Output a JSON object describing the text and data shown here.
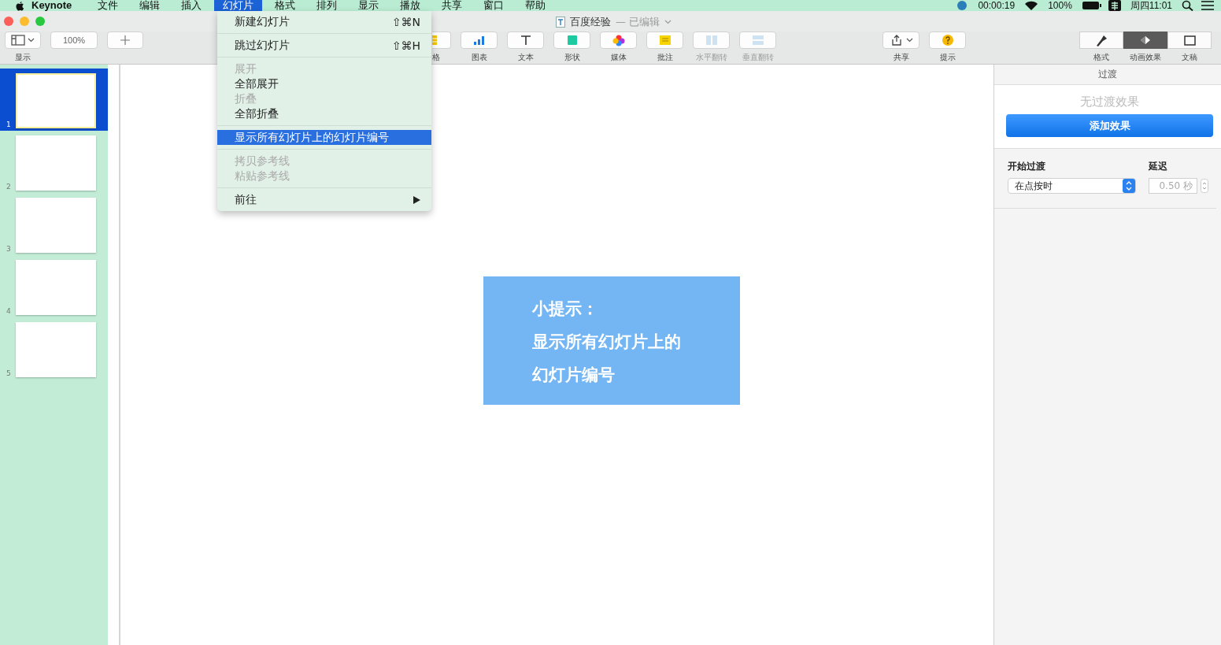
{
  "menubar": {
    "app": "Keynote",
    "menus": [
      {
        "label": "文件",
        "selected": false
      },
      {
        "label": "编辑",
        "selected": false
      },
      {
        "label": "插入",
        "selected": false
      },
      {
        "label": "幻灯片",
        "selected": true
      },
      {
        "label": "格式",
        "selected": false
      },
      {
        "label": "排列",
        "selected": false
      },
      {
        "label": "显示",
        "selected": false
      },
      {
        "label": "播放",
        "selected": false
      },
      {
        "label": "共享",
        "selected": false
      },
      {
        "label": "窗口",
        "selected": false
      },
      {
        "label": "帮助",
        "selected": false
      }
    ],
    "status": {
      "timer": "00:00:19",
      "battery": "100%",
      "clock": "周四11:01"
    }
  },
  "window": {
    "title": "百度经验",
    "subtitle": "— 已编辑"
  },
  "toolbar": {
    "left": [
      {
        "kind": "view",
        "label": "显示"
      },
      {
        "kind": "zoom",
        "value": "100%"
      },
      {
        "kind": "add"
      }
    ],
    "center": [
      {
        "label": "格",
        "disabled": false
      },
      {
        "label": "图表",
        "disabled": false
      },
      {
        "label": "文本",
        "disabled": false
      },
      {
        "label": "形状",
        "disabled": false
      },
      {
        "label": "媒体",
        "disabled": false
      },
      {
        "label": "批注",
        "disabled": false
      },
      {
        "label": "水平翻转",
        "disabled": true
      },
      {
        "label": "垂直翻转",
        "disabled": true
      }
    ],
    "right": [
      {
        "label": "共享"
      },
      {
        "label": "提示"
      }
    ],
    "inspector_tabs": [
      {
        "label": "格式",
        "selected": false
      },
      {
        "label": "动画效果",
        "selected": true
      },
      {
        "label": "文稿",
        "selected": false
      }
    ]
  },
  "menu": [
    {
      "kind": "item",
      "label": "新建幻灯片",
      "shortcut": "⇧⌘N",
      "disabled": false,
      "selected": false
    },
    {
      "kind": "separator"
    },
    {
      "kind": "item",
      "label": "跳过幻灯片",
      "shortcut": "⇧⌘H",
      "disabled": false,
      "selected": false
    },
    {
      "kind": "separator"
    },
    {
      "kind": "item",
      "label": "展开",
      "disabled": true,
      "selected": false
    },
    {
      "kind": "item",
      "label": "全部展开",
      "disabled": false,
      "selected": false
    },
    {
      "kind": "item",
      "label": "折叠",
      "disabled": true,
      "selected": false
    },
    {
      "kind": "item",
      "label": "全部折叠",
      "disabled": false,
      "selected": false
    },
    {
      "kind": "separator"
    },
    {
      "kind": "item",
      "label": "显示所有幻灯片上的幻灯片编号",
      "disabled": false,
      "selected": true
    },
    {
      "kind": "separator"
    },
    {
      "kind": "item",
      "label": "拷贝参考线",
      "disabled": true,
      "selected": false
    },
    {
      "kind": "item",
      "label": "粘贴参考线",
      "disabled": true,
      "selected": false
    },
    {
      "kind": "separator"
    },
    {
      "kind": "submenu",
      "label": "前往",
      "disabled": false,
      "selected": false
    }
  ],
  "slides": [
    {
      "number": "1",
      "selected": true
    },
    {
      "number": "2",
      "selected": false
    },
    {
      "number": "3",
      "selected": false
    },
    {
      "number": "4",
      "selected": false
    },
    {
      "number": "5",
      "selected": false
    }
  ],
  "slide_text": [
    "小提示：",
    "显示所有幻灯片上的",
    "幻灯片编号"
  ],
  "inspector": {
    "tab": "过渡",
    "empty": "无过渡效果",
    "add_button": "添加效果",
    "start_label": "开始过渡",
    "start_value": "在点按时",
    "delay_label": "延迟",
    "delay_value": "0.50 秒"
  }
}
